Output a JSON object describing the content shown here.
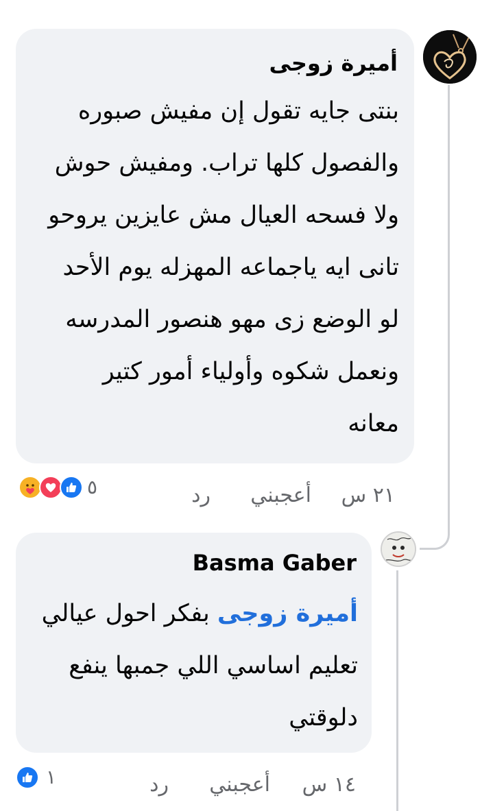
{
  "colors": {
    "bubble": "#f0f2f5",
    "meta_text": "#65676b",
    "mention": "#216fdb",
    "like_blue": "#1877f2",
    "love_red": "#f33e58",
    "care_yellow": "#f7b125"
  },
  "comments": [
    {
      "author": "أميرة زوجى",
      "lines": [
        "بنتى جايه تقول إن مفيش صبوره",
        "والفصول كلها تراب.  ومفيش حوش",
        "ولا فسحه العيال مش عايزين يروحو",
        "تانى ايه ياجماعه المهزله  يوم الأحد",
        "لو الوضع زى مهو هنصور المدرسه",
        "ونعمل شكوه  وأولياء أمور كتير",
        "معانه"
      ],
      "time": "٢١ س",
      "like_label": "أعجبني",
      "reply_label": "رد",
      "reaction_count": "٥",
      "reactions": [
        "like-icon",
        "love-icon",
        "care-icon"
      ]
    },
    {
      "author": "Basma Gaber",
      "mention": "أميرة زوجى",
      "lines": [
        "بفكر احول عيالي",
        "تعليم اساسي اللي جمبها ينفع",
        "دلوقتي"
      ],
      "time": "١٤ س",
      "like_label": "أعجبني",
      "reply_label": "رد",
      "reaction_count": "١",
      "reactions": [
        "like-icon"
      ]
    }
  ]
}
